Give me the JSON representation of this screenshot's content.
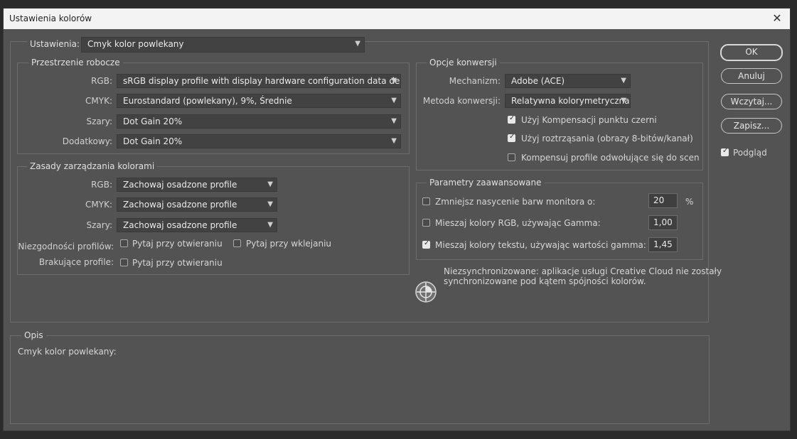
{
  "window": {
    "title": "Ustawienia kolorów",
    "close_glyph": "✕"
  },
  "settings": {
    "label": "Ustawienia:",
    "value": "Cmyk kolor powlekany"
  },
  "workspaces": {
    "title": "Przestrzenie robocze",
    "rgb_label": "RGB:",
    "rgb_value": "sRGB display profile with display hardware configuration data deriv...",
    "cmyk_label": "CMYK:",
    "cmyk_value": "Eurostandard (powlekany), 9%,  Średnie",
    "gray_label": "Szary:",
    "gray_value": "Dot Gain 20%",
    "spot_label": "Dodatkowy:",
    "spot_value": "Dot Gain 20%"
  },
  "policies": {
    "title": "Zasady zarządzania kolorami",
    "rgb_label": "RGB:",
    "rgb_value": "Zachowaj osadzone profile",
    "cmyk_label": "CMYK:",
    "cmyk_value": "Zachowaj osadzone profile",
    "gray_label": "Szary:",
    "gray_value": "Zachowaj osadzone profile",
    "mismatch_label": "Niezgodności profilów:",
    "mismatch_open": "Pytaj przy otwieraniu",
    "mismatch_paste": "Pytaj przy wklejaniu",
    "missing_label": "Brakujące profile:",
    "missing_open": "Pytaj przy otwieraniu"
  },
  "conversion": {
    "title": "Opcje konwersji",
    "engine_label": "Mechanizm:",
    "engine_value": "Adobe (ACE)",
    "intent_label": "Metoda konwersji:",
    "intent_value": "Relatywna kolorymetryczna",
    "bpc": "Użyj Kompensacji punktu czerni",
    "dither": "Użyj roztrząsania (obrazy 8-bitów/kanał)",
    "scene": "Kompensuj profile odwołujące się do scen"
  },
  "advanced": {
    "title": "Parametry zaawansowane",
    "desaturate": "Zmniejsz nasycenie barw monitora o:",
    "desaturate_value": "20",
    "desaturate_unit": "%",
    "blend_rgb": "Mieszaj kolory RGB, używając Gamma:",
    "blend_rgb_value": "1,00",
    "blend_text": "Mieszaj kolory tekstu, używając wartości gamma:",
    "blend_text_value": "1,45"
  },
  "sync": {
    "message_line1": "Niezsynchronizowane: aplikacje usługi Creative Cloud nie zostały",
    "message_line2": "synchronizowane pod kątem spójności kolorów.",
    "icon": "sync-status-icon"
  },
  "description": {
    "title": "Opis",
    "text": "Cmyk kolor powlekany:"
  },
  "buttons": {
    "ok": "OK",
    "cancel": "Anuluj",
    "load": "Wczytaj...",
    "save": "Zapisz...",
    "preview": "Podgląd"
  },
  "chevron": "⌄"
}
